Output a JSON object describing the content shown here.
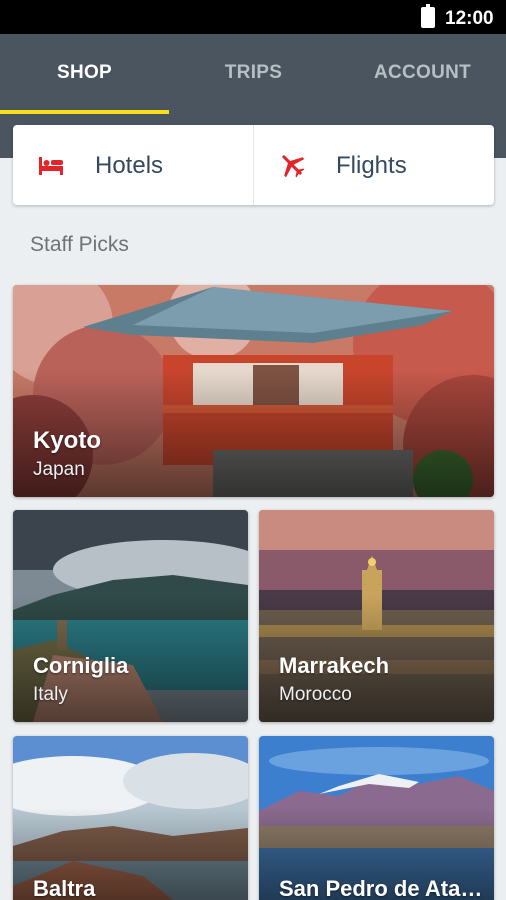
{
  "status_bar": {
    "time": "12:00",
    "battery_icon": "battery-full-icon"
  },
  "tabs": [
    {
      "label": "SHOP",
      "active": true
    },
    {
      "label": "TRIPS",
      "active": false
    },
    {
      "label": "ACCOUNT",
      "active": false
    }
  ],
  "services": {
    "hotels": {
      "label": "Hotels",
      "icon": "bed-icon"
    },
    "flights": {
      "label": "Flights",
      "icon": "airplane-icon"
    }
  },
  "staff_picks": {
    "title": "Staff Picks",
    "destinations": [
      {
        "city": "Kyoto",
        "country": "Japan"
      },
      {
        "city": "Corniglia",
        "country": "Italy"
      },
      {
        "city": "Marrakech",
        "country": "Morocco"
      },
      {
        "city": "Baltra",
        "country": ""
      },
      {
        "city": "San Pedro de Ata…",
        "country": ""
      }
    ]
  },
  "colors": {
    "header": "#4a5560",
    "tab_indicator": "#f6df18",
    "service_icon": "#e3242b",
    "service_text": "#34495e",
    "background": "#eceff1"
  }
}
